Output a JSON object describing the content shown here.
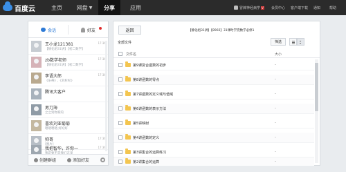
{
  "topbar": {
    "brand": "百度云",
    "nav": [
      {
        "label": "主页",
        "active": false
      },
      {
        "label": "网盘",
        "active": false,
        "has_dropdown": true
      },
      {
        "label": "分享",
        "active": true
      },
      {
        "label": "应用",
        "active": false
      }
    ],
    "user_name": "冒牌神经病学",
    "user_badge": "V",
    "links": [
      "会员中心",
      "客户端下载",
      "通知",
      "帮助"
    ]
  },
  "left_panel": {
    "tabs": [
      {
        "label": "会话",
        "icon": "chat-bubble-icon",
        "active": true
      },
      {
        "label": "好友",
        "icon": "person-icon",
        "active": false,
        "has_new": true
      }
    ],
    "contacts": [
      {
        "name": "王小龙121381",
        "message": "【静化组31讲】【初二数学】",
        "time": "17:36"
      },
      {
        "name": "zb数学老师",
        "message": "【静化组31讲】【初二数学】",
        "time": "17:36"
      },
      {
        "name": "李语大郎",
        "message": "《乐蒂》,《刘杉杉》",
        "time": "17:36"
      },
      {
        "name": "腾讯大客户",
        "message": "",
        "time": ""
      },
      {
        "name": "男刀海",
        "message": "之之到你家的",
        "time": ""
      },
      {
        "name": "喜欢刘亚菊菊",
        "message": "嗯嗯嗯嗯,好好好",
        "time": ""
      },
      {
        "name": "帅哥",
        "message": "[图片]",
        "time": "17:36"
      },
      {
        "name": "我把智华，许你一",
        "message": "我是要不是我们这里",
        "time": "17:36"
      },
      {
        "name": "",
        "message": "",
        "time": ""
      }
    ],
    "bottom": {
      "create_group": "创建群组",
      "add_friend": "添加好友"
    }
  },
  "right_panel": {
    "back_label": "返回",
    "share_title": "【静化组31讲】【8902】31课时学完数学必修1",
    "all_files_label": "全部文件",
    "filter_label": "筛选",
    "columns": {
      "name": "文件名",
      "size": "大小"
    },
    "files": [
      {
        "name": "第9课复合函数的初步",
        "size": "-"
      },
      {
        "name": "第8讲函数的零点",
        "size": "-"
      },
      {
        "name": "第7讲函数的定义域与值域",
        "size": "-"
      },
      {
        "name": "第6讲函数的表示方法",
        "size": "-"
      },
      {
        "name": "第5讲映射",
        "size": "-"
      },
      {
        "name": "第4讲函数的定义",
        "size": "-"
      },
      {
        "name": "第3讲集合的运算练习",
        "size": "-"
      },
      {
        "name": "第2讲集合的运算",
        "size": "-"
      }
    ]
  }
}
